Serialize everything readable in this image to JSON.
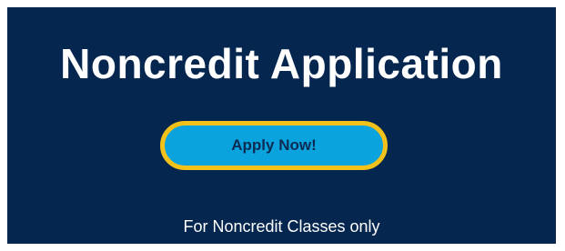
{
  "panel": {
    "title": "Noncredit Application",
    "button_label": "Apply Now!",
    "note": "For Noncredit Classes only"
  },
  "colors": {
    "background": "#05264f",
    "button_fill": "#0aa3de",
    "button_border": "#f2c21b",
    "button_text": "#0c2b52",
    "text": "#ffffff"
  }
}
